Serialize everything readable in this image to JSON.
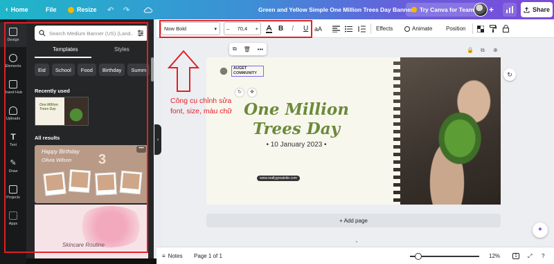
{
  "topbar": {
    "home": "Home",
    "file": "File",
    "resize": "Resize",
    "doc_title": "Green and Yellow Simple One Million Trees Day Banner",
    "try_teams": "Try Canva for Teams",
    "share": "Share",
    "gradient_colors": [
      "#1fb6c9",
      "#3d8fd6",
      "#6a5cdc",
      "#7b4ad8"
    ]
  },
  "rail": {
    "items": [
      {
        "label": "Design",
        "icon": "design-icon"
      },
      {
        "label": "Elements",
        "icon": "elements-icon"
      },
      {
        "label": "Brand Hub",
        "icon": "brand-hub-icon"
      },
      {
        "label": "Uploads",
        "icon": "uploads-icon"
      },
      {
        "label": "Text",
        "icon": "text-icon"
      },
      {
        "label": "Draw",
        "icon": "draw-icon"
      },
      {
        "label": "Projects",
        "icon": "projects-icon"
      },
      {
        "label": "Apps",
        "icon": "apps-icon"
      }
    ]
  },
  "panel": {
    "search_placeholder": "Search Medium Banner (US) (Land...",
    "tabs": [
      "Templates",
      "Styles"
    ],
    "chips": [
      "Eid",
      "School",
      "Food",
      "Birthday",
      "Summ"
    ],
    "recently_used": "Recently used",
    "recent_thumb_title": "One Million Trees Day",
    "all_results": "All results",
    "template1_line1": "Happy Birthday",
    "template1_line2": "Olivia Wilson",
    "template1_number": "3",
    "template2_title": "Skincare Routine"
  },
  "toolbar": {
    "font": "Now Bold",
    "size": "70,4",
    "effects": "Effects",
    "animate": "Animate",
    "position": "Position",
    "text_color": "#222222"
  },
  "design": {
    "logo_text": "AUGET COMMUNITY",
    "headline_line1": "One Million",
    "headline_line2": "Trees Day",
    "date": "• 10 January 2023 •",
    "website": "www.reallygreatsite.com",
    "headline_color": "#6c8a3b"
  },
  "annotation": {
    "text": "Công cụ chỉnh sửa font, size, màu chữ",
    "color": "#e21f26"
  },
  "canvas": {
    "add_page": "+ Add page"
  },
  "bottombar": {
    "notes": "Notes",
    "page": "Page 1 of 1",
    "zoom": "12%",
    "zoom_level": 0.12,
    "page_count": "1"
  }
}
